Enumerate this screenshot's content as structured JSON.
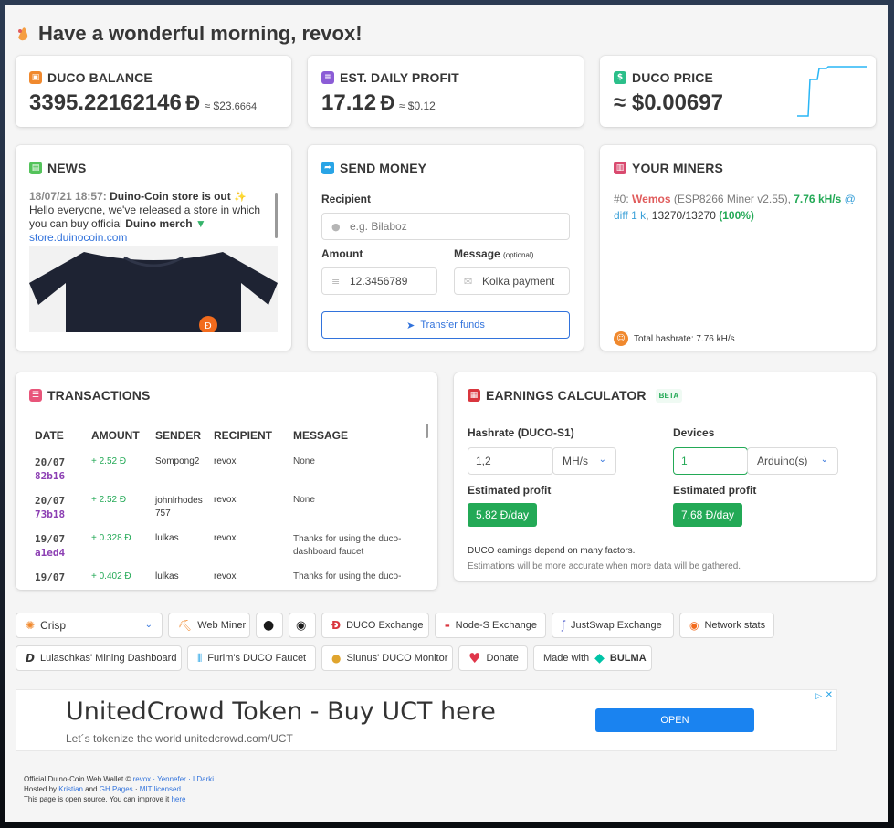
{
  "greeting": "Have a wonderful morning, revox!",
  "balance": {
    "title": "DUCO BALANCE",
    "int": "3395",
    "frac": ".22162146",
    "symbol": "Ð",
    "approx_prefix": "≈ $",
    "usd_int": "23",
    "usd_frac": ".6664"
  },
  "profit": {
    "title": "EST. DAILY PROFIT",
    "int": "17",
    "frac": ".12",
    "symbol": "Ð",
    "approx_prefix": "≈ $",
    "usd_int": "0",
    "usd_frac": ".12"
  },
  "price": {
    "title": "DUCO PRICE",
    "prefix": "≈ $",
    "int": "0",
    "frac": ".00697"
  },
  "news": {
    "title": "NEWS",
    "date": "18/07/21 18:57:",
    "headline": "Duino-Coin store is out",
    "body_1": "Hello everyone, we've released a store in which you can buy official",
    "body_bold": "Duino merch",
    "link": "store.duinocoin.com"
  },
  "send": {
    "title": "SEND MONEY",
    "recipient_label": "Recipient",
    "recipient_placeholder": "e.g. Bilaboz",
    "amount_label": "Amount",
    "amount_value": "12.3456789",
    "message_label": "Message",
    "message_optional": "(optional)",
    "message_value": "Kolka payment",
    "button": "Transfer funds"
  },
  "miners": {
    "title": "YOUR MINERS",
    "index": "#0:",
    "name": "Wemos",
    "software": "(ESP8266 Miner v2.55),",
    "hashrate": "7.76 kH/s",
    "at": "@",
    "diff": "diff 1 k",
    "shares": ", 13270/13270",
    "percent": "(100%)",
    "total": "Total hashrate: 7.76 kH/s"
  },
  "transactions": {
    "title": "TRANSACTIONS",
    "headers": [
      "DATE",
      "AMOUNT",
      "SENDER",
      "RECIPIENT",
      "MESSAGE"
    ],
    "rows": [
      {
        "date": "20/07",
        "hash": "82b16",
        "amount": "+ 2.52 Ð",
        "sender": "Sompong2",
        "recipient": "revox",
        "message": "None"
      },
      {
        "date": "20/07",
        "hash": "73b18",
        "amount": "+ 2.52 Ð",
        "sender": "johnlrhodes757",
        "recipient": "revox",
        "message": "None"
      },
      {
        "date": "19/07",
        "hash": "a1ed4",
        "amount": "+ 0.328 Ð",
        "sender": "lulkas",
        "recipient": "revox",
        "message": "Thanks for using the duco-dashboard faucet"
      },
      {
        "date": "19/07",
        "hash": "",
        "amount": "+ 0.402 Ð",
        "sender": "lulkas",
        "recipient": "revox",
        "message": "Thanks for using the duco-"
      }
    ]
  },
  "calculator": {
    "title": "EARNINGS CALCULATOR",
    "beta": "BETA",
    "hashrate_label": "Hashrate (DUCO-S1)",
    "hashrate_value": "1,2",
    "hashrate_unit": "MH/s",
    "devices_label": "Devices",
    "devices_value": "1",
    "devices_unit": "Arduino(s)",
    "est_label_1": "Estimated profit",
    "est_value_1": "5.82 Ð/day",
    "est_label_2": "Estimated profit",
    "est_value_2": "7.68 Ð/day",
    "note_1": "DUCO earnings depend on many factors.",
    "note_2": "Estimations will be more accurate when more data will be gathered."
  },
  "links": {
    "crisp": "Crisp",
    "web_miner": "Web Miner",
    "duco_exchange": "DUCO Exchange",
    "nodes_exchange": "Node-S Exchange",
    "justswap": "JustSwap Exchange",
    "network_stats": "Network stats",
    "lulaschkas": "Lulaschkas' Mining Dashboard",
    "furim": "Furim's DUCO Faucet",
    "siunus": "Siunus' DUCO Monitor",
    "donate": "Donate",
    "made_with": "Made with",
    "bulma": "BULMA"
  },
  "ad": {
    "headline": "UnitedCrowd Token - Buy UCT here",
    "sub": "Let´s tokenize the world unitedcrowd.com/UCT",
    "button": "OPEN"
  },
  "footer": {
    "line1_a": "Official Duino-Coin Web Wallet © ",
    "line1_b": "revox · Yennefer · LDarki",
    "line2_a": "Hosted by ",
    "line2_b": "Kristian",
    "line2_c": " and ",
    "line2_d": "GH Pages",
    "line2_e": " · ",
    "line2_f": "MIT licensed",
    "line3_a": "This page is open source. You can improve it ",
    "line3_b": "here"
  },
  "colors": {
    "accent": "#3273dc",
    "success": "#23a956",
    "miner_name": "#e05b5b",
    "hash": "#8c3fb3"
  }
}
